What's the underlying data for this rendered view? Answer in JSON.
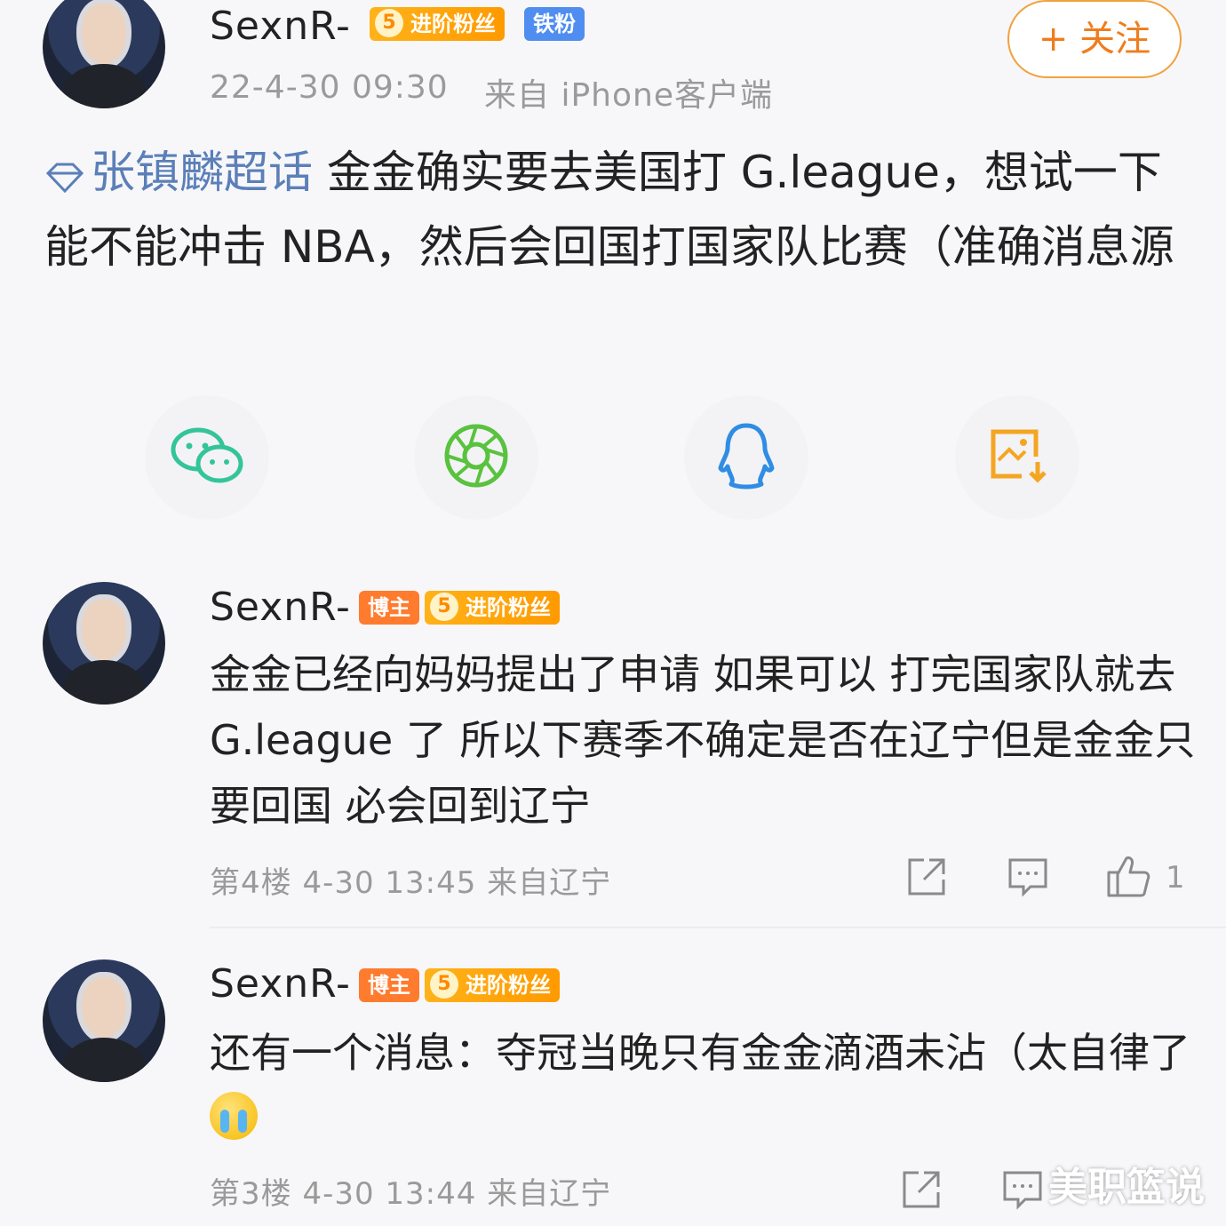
{
  "post": {
    "author": "SexnR-",
    "badges": {
      "fan_level": "5",
      "fan_label": "进阶粉丝",
      "iron": "铁粉"
    },
    "time": "22-4-30 09:30",
    "source": "来自 iPhone客户端",
    "follow_label": "+ 关注",
    "topic": "张镇麟超话",
    "body": " 金金确实要去美国打 G.league，想试一下能不能冲击 NBA，然后会回国打国家队比赛（准确消息源"
  },
  "share": [
    "wechat-icon",
    "moments-icon",
    "qq-icon",
    "save-image-icon"
  ],
  "comments": [
    {
      "author": "SexnR-",
      "host_badge": "博主",
      "fan_level": "5",
      "fan_label": "进阶粉丝",
      "text": "金金已经向妈妈提出了申请 如果可以 打完国家队就去 G.league 了 所以下赛季不确定是否在辽宁但是金金只要回国 必会回到辽宁",
      "meta": "第4楼  4-30 13:45  来自辽宁",
      "likes": "1"
    },
    {
      "author": "SexnR-",
      "host_badge": "博主",
      "fan_level": "5",
      "fan_label": "进阶粉丝",
      "text": "还有一个消息：夺冠当晚只有金金滴酒未沾（太自律了",
      "meta": "第3楼  4-30 13:44  来自辽宁",
      "likes": ""
    }
  ],
  "watermark": "美职篮说",
  "colors": {
    "accent": "#ef7d1c",
    "topic": "#5b7fb8",
    "fan_badge": "#ff9a00",
    "iron_badge": "#4f8ef0",
    "host_badge": "#ff7b2e"
  }
}
